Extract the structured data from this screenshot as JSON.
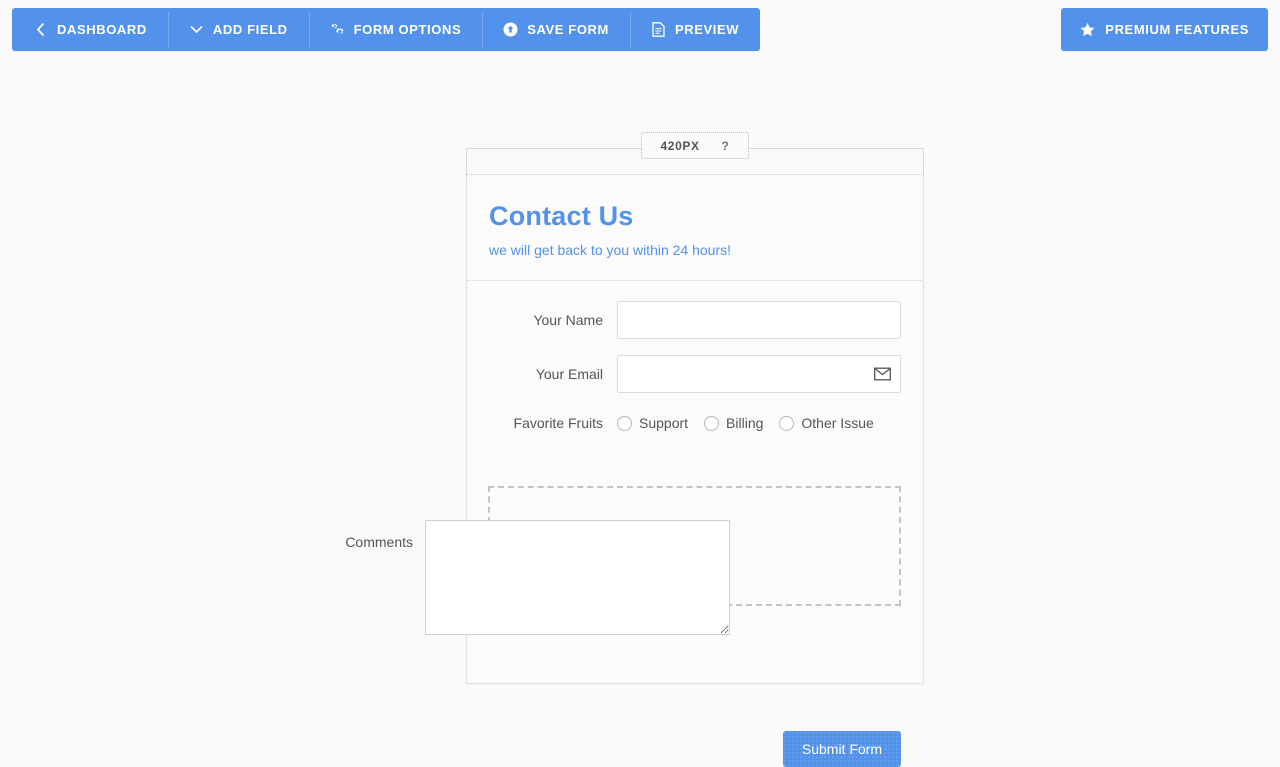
{
  "toolbar": {
    "items": [
      {
        "label": "Dashboard",
        "icon": "chevron-left-icon"
      },
      {
        "label": "Add Field",
        "icon": "chevron-down-icon"
      },
      {
        "label": "Form Options",
        "icon": "cogs-icon"
      },
      {
        "label": "Save Form",
        "icon": "upload-circle-icon"
      },
      {
        "label": "Preview",
        "icon": "document-icon"
      }
    ],
    "premium": {
      "label": "Premium Features",
      "icon": "star-icon"
    }
  },
  "ruler": {
    "width_value": "420PX",
    "help": "?"
  },
  "form": {
    "title": "Contact Us",
    "subtitle": "we will get back to you within 24 hours!",
    "fields": [
      {
        "label": "Your Name",
        "value": "",
        "placeholder": "",
        "icon": ""
      },
      {
        "label": "Your Email",
        "value": "",
        "placeholder": "",
        "icon": "envelope-icon"
      }
    ],
    "radio_group": {
      "label": "Favorite Fruits",
      "options": [
        {
          "label": "Support"
        },
        {
          "label": "Billing"
        },
        {
          "label": "Other Issue"
        }
      ]
    },
    "dragged_field": {
      "label": "Comments",
      "value": "",
      "placeholder": ""
    },
    "submit_label": "Submit Form"
  },
  "colors": {
    "brand_blue": "#5392ea",
    "page_bg": "#fafafa",
    "label_gray": "#555555",
    "border_gray": "#dcdcdc"
  }
}
